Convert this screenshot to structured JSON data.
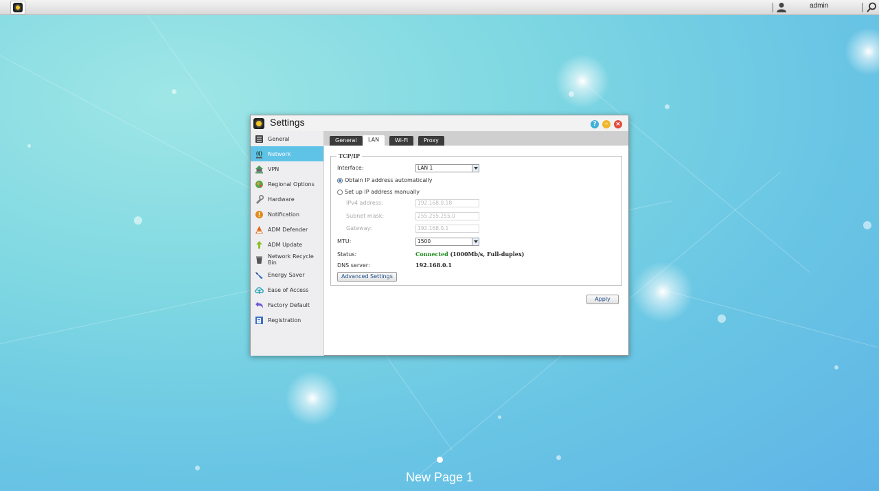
{
  "topbar": {
    "app_icon": "settings-gear-icon",
    "user_name": "admin",
    "user_icon": "user-icon",
    "search_icon": "search-icon"
  },
  "window": {
    "title": "Settings",
    "controls": [
      "help-icon",
      "minimize-icon",
      "close-icon"
    ]
  },
  "sidebar": {
    "items": [
      {
        "label": "General",
        "icon": "general-icon",
        "color": "#444444"
      },
      {
        "label": "Network",
        "icon": "network-globe-icon",
        "color": "#2c6e8a",
        "active": true
      },
      {
        "label": "VPN",
        "icon": "vpn-icon",
        "color": "#4a9a5a"
      },
      {
        "label": "Regional Options",
        "icon": "regional-globe-icon",
        "color": "#5aa84a"
      },
      {
        "label": "Hardware",
        "icon": "hardware-icon",
        "color": "#7d7d7d"
      },
      {
        "label": "Notification",
        "icon": "notification-icon",
        "color": "#e08a1a"
      },
      {
        "label": "ADM Defender",
        "icon": "defender-icon",
        "color": "#e06a1a"
      },
      {
        "label": "ADM Update",
        "icon": "update-arrow-icon",
        "color": "#8bbf2a"
      },
      {
        "label": "Network Recycle Bin",
        "icon": "recycle-bin-icon",
        "color": "#555555"
      },
      {
        "label": "Energy Saver",
        "icon": "energy-saver-icon",
        "color": "#3a6fc4"
      },
      {
        "label": "Ease of Access",
        "icon": "cloud-access-icon",
        "color": "#2aa5b8"
      },
      {
        "label": "Factory Default",
        "icon": "factory-default-icon",
        "color": "#6a5acd"
      },
      {
        "label": "Registration",
        "icon": "registration-icon",
        "color": "#3a6fc4"
      }
    ]
  },
  "tabs": [
    {
      "label": "General",
      "active": false
    },
    {
      "label": "LAN",
      "active": true
    },
    {
      "label": "Wi-Fi",
      "active": false
    },
    {
      "label": "Proxy",
      "active": false
    }
  ],
  "tcpip": {
    "legend": "TCP/IP",
    "interface_label": "Interface:",
    "interface_value": "LAN 1",
    "obtain_auto_label": "Obtain IP address automatically",
    "manual_label": "Set up IP address manually",
    "ipv4_label": "IPv4 address:",
    "ipv4_value": "192.168.0.18",
    "subnet_label": "Subnet mask:",
    "subnet_value": "255.255.255.0",
    "gateway_label": "Gateway:",
    "gateway_value": "192.168.0.1",
    "mtu_label": "MTU:",
    "mtu_value": "1500",
    "status_label": "Status:",
    "status_state": "Connected",
    "status_detail": "(1000Mb/s, Full-duplex)",
    "dns_label": "DNS server:",
    "dns_value": "192.168.0.1",
    "advanced_button": "Advanced Settings"
  },
  "apply_button": "Apply",
  "desktop": {
    "page_label": "New Page 1"
  },
  "colors": {
    "active_item": "#5fc3e8",
    "tab_dark": "#3b3b3b",
    "connected": "#1c8a1c"
  }
}
